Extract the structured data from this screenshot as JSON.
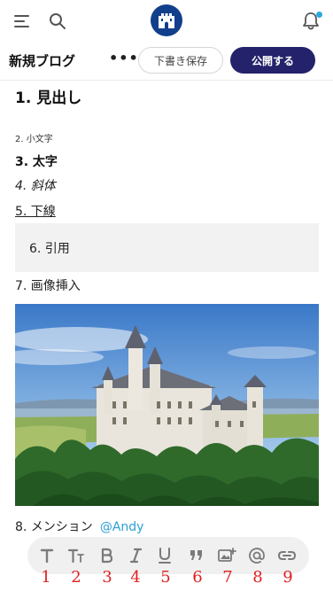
{
  "header": {
    "icons": [
      "menu-icon",
      "search-icon",
      "castle-logo-icon",
      "bell-icon"
    ],
    "notification_dot_color": "#2aa8e0",
    "logo_color": "#123f8c"
  },
  "actions": {
    "title": "新規ブログ",
    "more_label": "•••",
    "draft_label": "下書き保存",
    "publish_label": "公開する",
    "publish_color": "#23226b"
  },
  "content": {
    "heading": "1. 見出し",
    "small_text": "2. 小文字",
    "bold_text": "3. 太字",
    "italic_text": "4. 斜体",
    "underline_text": "5. 下線",
    "quote_text": "6. 引用",
    "image_label": "7. 画像挿入",
    "image_subject": "castle-photo",
    "mention_label": "8. メンション",
    "mention_user": "@Andy",
    "mention_color": "#2b9fd6"
  },
  "toolbar": {
    "items": [
      {
        "icon": "text-icon",
        "number": "1"
      },
      {
        "icon": "text-size-icon",
        "number": "2"
      },
      {
        "icon": "bold-icon",
        "number": "3"
      },
      {
        "icon": "italic-icon",
        "number": "4"
      },
      {
        "icon": "underline-icon",
        "number": "5"
      },
      {
        "icon": "quote-icon",
        "number": "6"
      },
      {
        "icon": "image-add-icon",
        "number": "7"
      },
      {
        "icon": "mention-icon",
        "number": "8"
      },
      {
        "icon": "link-icon",
        "number": "9"
      }
    ],
    "number_color": "#e02020"
  }
}
